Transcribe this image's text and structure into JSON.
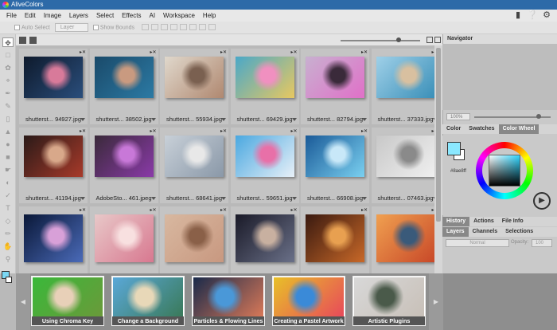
{
  "app": {
    "title": "AliveColors"
  },
  "menu": [
    "File",
    "Edit",
    "Image",
    "Layers",
    "Select",
    "Effects",
    "AI",
    "Workspace",
    "Help"
  ],
  "top_icons": [
    "notification-icon",
    "help-icon",
    "settings-icon"
  ],
  "options": {
    "auto_select": "Auto Select",
    "layer_select": "Layer",
    "show_bounds": "Show Bounds"
  },
  "browser": {
    "files": [
      {
        "name": "shutterst... 94927.jpg",
        "colors": [
          "#0e1a2c",
          "#2a4e7c",
          "#d87a9a"
        ]
      },
      {
        "name": "shutterst... 38502.jpg",
        "colors": [
          "#1a4a6a",
          "#2c7aa4",
          "#c99a80"
        ]
      },
      {
        "name": "shutterst... 55934.jpg",
        "colors": [
          "#e0d8cc",
          "#b08870",
          "#7a6050"
        ]
      },
      {
        "name": "shutterst... 69429.jpg",
        "colors": [
          "#4aa8c8",
          "#e8c860",
          "#f090c0"
        ]
      },
      {
        "name": "shutterst... 82794.jpg",
        "colors": [
          "#c8b0d0",
          "#e070c8",
          "#3a2a3a"
        ]
      },
      {
        "name": "shutterst... 37333.jpg",
        "colors": [
          "#9fd0e8",
          "#3a8fb8",
          "#d8c0a0"
        ]
      },
      {
        "name": "shutterst... 41194.jpg",
        "colors": [
          "#2a1a18",
          "#a83a2a",
          "#d8a88a"
        ]
      },
      {
        "name": "AdobeSto... 461.jpeg",
        "colors": [
          "#3a2a3a",
          "#8a3aa8",
          "#c878d8"
        ]
      },
      {
        "name": "shutterst... 68641.jpg",
        "colors": [
          "#c8d0d8",
          "#8a98a8",
          "#e8e8e8"
        ]
      },
      {
        "name": "shutterst... 59651.jpg",
        "colors": [
          "#4aa8e0",
          "#e8f0f8",
          "#e870a8"
        ]
      },
      {
        "name": "shutterst... 66908.jpg",
        "colors": [
          "#1a5a98",
          "#7ad0f0",
          "#c8e8f8"
        ]
      },
      {
        "name": "shutterst... 07463.jpg",
        "colors": [
          "#c8c8c8",
          "#f0f0f0",
          "#8a8a8a"
        ]
      },
      {
        "name": "",
        "colors": [
          "#0a1838",
          "#4a6ab8",
          "#d8a0d8"
        ]
      },
      {
        "name": "",
        "colors": [
          "#e8c8c8",
          "#d87890",
          "#f8e0e0"
        ]
      },
      {
        "name": "",
        "colors": [
          "#d8b8a0",
          "#c89880",
          "#8a6048"
        ]
      },
      {
        "name": "",
        "colors": [
          "#1a1a28",
          "#6a7088",
          "#c8b0a0"
        ]
      },
      {
        "name": "",
        "colors": [
          "#3a1a10",
          "#c86828",
          "#e8a050"
        ]
      },
      {
        "name": "",
        "colors": [
          "#f0a050",
          "#c84828",
          "#3a5a7a"
        ]
      }
    ]
  },
  "panel": {
    "navigator_title": "Navigator",
    "zoom": "100%",
    "color_tabs": [
      "Color",
      "Swatches",
      "Color Wheel"
    ],
    "active_color_tab": "Color Wheel",
    "hex": "#8ae8ff",
    "foreground": "#8ae8ff",
    "history_tabs": [
      "History",
      "Actions",
      "File Info"
    ],
    "layers_tabs": [
      "Layers",
      "Channels",
      "Selections"
    ],
    "blend_mode": "Normal",
    "opacity_label": "Opacity:",
    "opacity_value": "100"
  },
  "tutorials": [
    {
      "label": "Using Chroma Key",
      "colors": [
        "#3ab83a",
        "#e8d0b8",
        "#6a9a3a"
      ]
    },
    {
      "label": "Change a Background",
      "colors": [
        "#5aa8d8",
        "#e8d8b8",
        "#3a7a5a"
      ]
    },
    {
      "label": "Particles & Flowing Lines",
      "colors": [
        "#1a2a4a",
        "#4a98d8",
        "#d87858"
      ]
    },
    {
      "label": "Creating a Pastel Artwork",
      "colors": [
        "#e8c028",
        "#3a8ad8",
        "#e84a5a"
      ]
    },
    {
      "label": "Artistic Plugins",
      "colors": [
        "#d8d8d8",
        "#4a5a4a",
        "#c8c0b8"
      ]
    }
  ]
}
